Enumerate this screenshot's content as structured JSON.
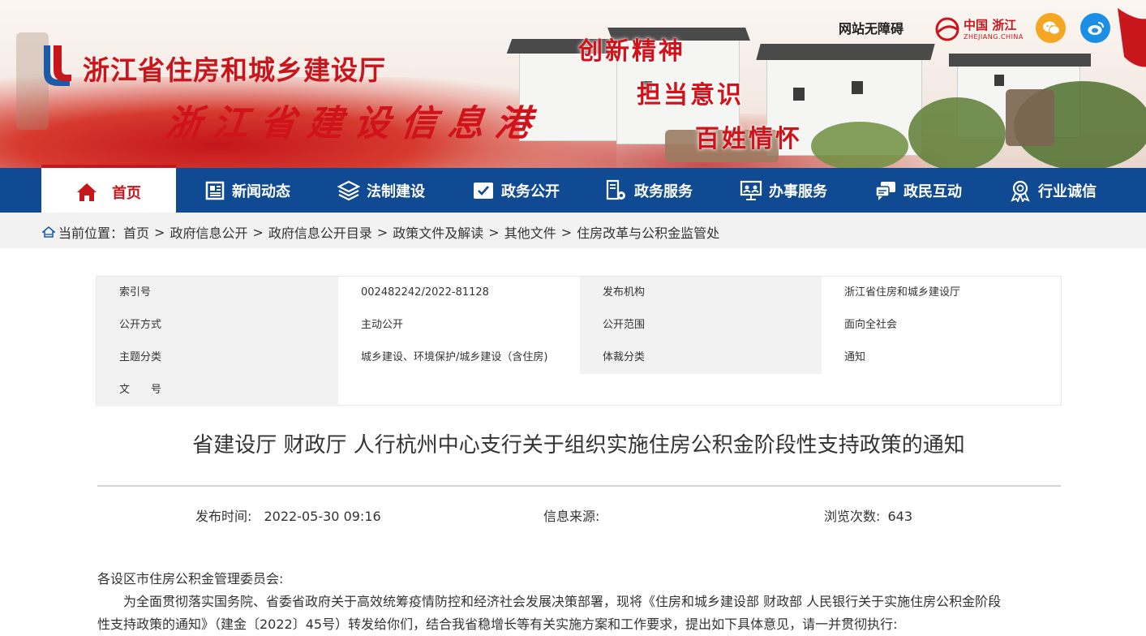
{
  "header": {
    "site_name": "浙江省住房和城乡建设厅",
    "slogan": "浙江省建设信息港",
    "mottos": [
      "创新精神",
      "担当意识",
      "百姓情怀"
    ],
    "accessibility_label": "网站无障碍",
    "zhejiang_logo_text": "中国 浙江",
    "zhejiang_logo_sub": "ZHEJIANG.CHINA",
    "brand_red": "#c8161d",
    "nav_blue": "#0f4a93"
  },
  "nav": {
    "items": [
      {
        "label": "首页",
        "icon": "home-icon",
        "active": true
      },
      {
        "label": "新闻动态",
        "icon": "news-icon"
      },
      {
        "label": "法制建设",
        "icon": "layers-icon"
      },
      {
        "label": "政务公开",
        "icon": "check-board-icon"
      },
      {
        "label": "政务服务",
        "icon": "service-gear-icon"
      },
      {
        "label": "办事服务",
        "icon": "users-screen-icon"
      },
      {
        "label": "政民互动",
        "icon": "chat-icon"
      },
      {
        "label": "行业诚信",
        "icon": "medal-icon"
      }
    ]
  },
  "breadcrumb": {
    "prefix": "当前位置：",
    "items": [
      "首页",
      "政府信息公开",
      "政府信息公开目录",
      "政策文件及解读",
      "其他文件",
      "住房改革与公积金监管处"
    ],
    "separator": ">"
  },
  "meta": {
    "rows": [
      {
        "label1": "索引号",
        "value1": "002482242/2022-81128",
        "label2": "发布机构",
        "value2": "浙江省住房和城乡建设厅"
      },
      {
        "label1": "公开方式",
        "value1": "主动公开",
        "label2": "公开范围",
        "value2": "面向全社会"
      },
      {
        "label1": "主题分类",
        "value1": "城乡建设、环境保护/城乡建设（含住房)",
        "label2": "体裁分类",
        "value2": "通知"
      },
      {
        "label1": "文　　号",
        "value1": "",
        "label2": "",
        "value2": ""
      }
    ]
  },
  "article": {
    "title": "省建设厅 财政厅 人行杭州中心支行关于组织实施住房公积金阶段性支持政策的通知",
    "publish_label": "发布时间:",
    "publish_time": "2022-05-30 09:16",
    "source_label": "信息来源:",
    "source_value": "",
    "views_label": "浏览次数:",
    "views": "643",
    "salutation": "各设区市住房公积金管理委员会:",
    "paragraph1_line1": "为全面贯彻落实国务院、省委省政府关于高效统筹疫情防控和经济社会发展决策部署，现将《住房和城乡建设部 财政部 人民银行关于实施住房公积金阶段",
    "paragraph1_line2": "性支持政策的通知》（建金〔2022〕45号）转发给你们，结合我省稳增长等有关实施方案和工作要求，提出如下具体意见，请一并贯彻执行:"
  }
}
